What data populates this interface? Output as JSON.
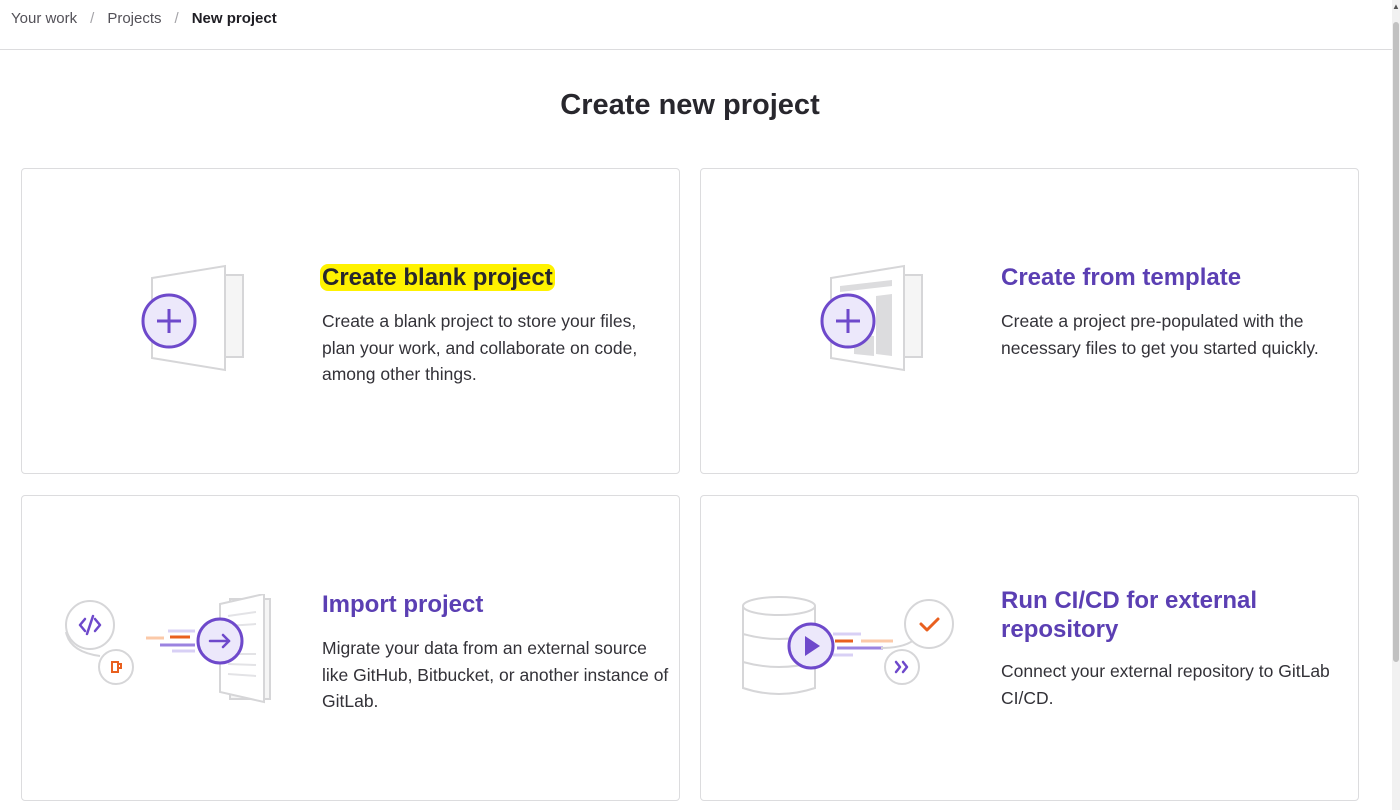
{
  "breadcrumb": {
    "items": [
      {
        "label": "Your work"
      },
      {
        "label": "Projects"
      },
      {
        "label": "New project"
      }
    ],
    "separator": "/"
  },
  "page": {
    "title": "Create new project"
  },
  "cards": [
    {
      "title": "Create blank project",
      "description": "Create a blank project to store your files, plan your work, and collaborate on code, among other things.",
      "highlighted": true,
      "icon": "blank-project-illustration"
    },
    {
      "title": "Create from template",
      "description": "Create a project pre-populated with the necessary files to get you started quickly.",
      "icon": "template-project-illustration"
    },
    {
      "title": "Import project",
      "description": "Migrate your data from an external source like GitHub, Bitbucket, or another instance of GitLab.",
      "icon": "import-project-illustration"
    },
    {
      "title": "Run CI/CD for external repository",
      "description": "Connect your external repository to GitLab CI/CD.",
      "icon": "cicd-external-illustration"
    }
  ],
  "colors": {
    "accent": "#5b3fb3",
    "orange": "#e9601f",
    "highlight": "#fff200",
    "border": "#dcdcde"
  }
}
